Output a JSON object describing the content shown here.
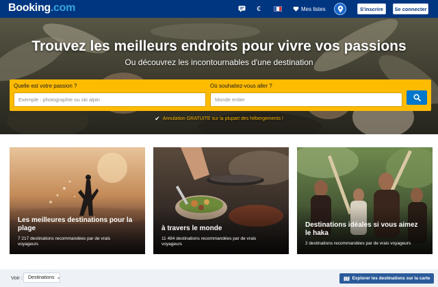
{
  "header": {
    "logo_main": "Booking",
    "logo_domain": ".com",
    "icons": [
      "chat-icon",
      "currency-icon",
      "flag-fr-icon",
      "heart-icon",
      "map-pin-icon"
    ],
    "currency_symbol": "€",
    "lists_label": "Mes listes",
    "register_label": "S'inscrire",
    "login_label": "Se connecter",
    "colors": {
      "brand": "#003580",
      "accent": "#febb02",
      "link": "#37a6e0",
      "button": "#0077cc"
    }
  },
  "hero": {
    "title": "Trouvez les meilleurs endroits pour vivre vos passions",
    "subtitle": "Ou découvrez les incontournables d'une destination",
    "passion_label": "Quelle est votre passion ?",
    "passion_placeholder": "Exemple : photographie ou ski alpin",
    "destination_label": "Où souhaitez-vous aller ?",
    "destination_placeholder": "Monde entier",
    "search_icon": "search-icon",
    "cancellation_text": "Annulation GRATUITE sur la plupart des hébergements !"
  },
  "cards": [
    {
      "title_line1": "Les meilleures destinations pour la",
      "title_line2": "plage",
      "desc_line1": "7 217 destinations recommandées par de vrais",
      "desc_line2": "voyageurs"
    },
    {
      "title_line1": "à travers le monde",
      "desc_line1": "11 484 destinations recommandées par de vrais",
      "desc_line2": "voyageurs"
    },
    {
      "title_line1": "Destinations idéales si vous aimez",
      "title_line2": "le haka",
      "desc_line1": "2 destinations recommandées par de vrais voyageurs"
    }
  ],
  "bottom": {
    "view_label": "Voir :",
    "view_value": "Destinations",
    "map_button": "Explorer les destinations sur la carte"
  }
}
